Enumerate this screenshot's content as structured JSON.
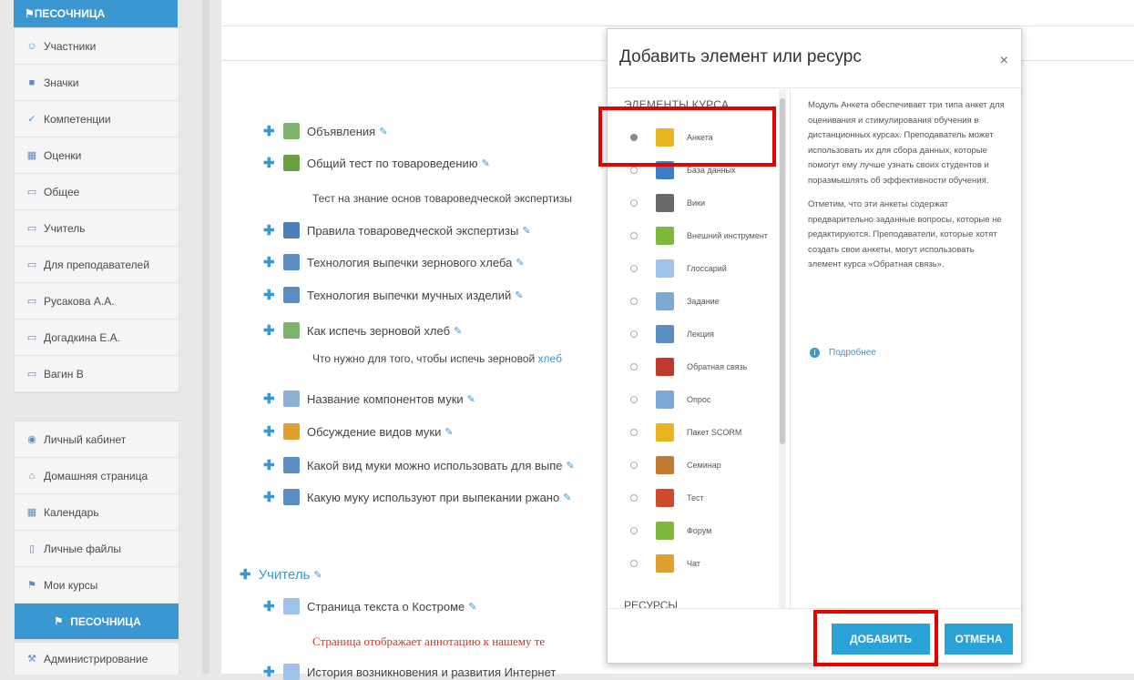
{
  "sidebar": {
    "top_label": "ПЕСОЧНИЦА",
    "group1": [
      {
        "label": "Участники",
        "icon": "users-icon"
      },
      {
        "label": "Значки",
        "icon": "badge-icon"
      },
      {
        "label": "Компетенции",
        "icon": "check-icon"
      },
      {
        "label": "Оценки",
        "icon": "table-icon"
      },
      {
        "label": "Общее",
        "icon": "folder-icon"
      },
      {
        "label": "Учитель",
        "icon": "folder-icon"
      },
      {
        "label": "Для преподавателей",
        "icon": "folder-icon"
      },
      {
        "label": "Русакова А.А.",
        "icon": "folder-icon"
      },
      {
        "label": "Догадкина Е.А.",
        "icon": "folder-icon"
      },
      {
        "label": "Вагин В",
        "icon": "folder-icon"
      }
    ],
    "group2": [
      {
        "label": "Личный кабинет",
        "icon": "dashboard-icon"
      },
      {
        "label": "Домашняя страница",
        "icon": "home-icon"
      },
      {
        "label": "Календарь",
        "icon": "calendar-icon"
      },
      {
        "label": "Личные файлы",
        "icon": "file-icon"
      },
      {
        "label": "Мои курсы",
        "icon": "graduation-cap-icon"
      }
    ],
    "active_label": "ПЕСОЧНИЦА",
    "admin_label": "Администрирование"
  },
  "course": {
    "items": [
      {
        "label": "Объявления",
        "color": "#7db36a"
      },
      {
        "label": "Общий тест по товароведению",
        "color": "#6aa03e"
      },
      {
        "label": "Правила товароведческой экспертизы",
        "color": "#4f7fb8"
      },
      {
        "label": "Технология выпечки зернового хлеба",
        "color": "#5b8cc2"
      },
      {
        "label": "Технология выпечки мучных изделий",
        "color": "#5b8cc2"
      },
      {
        "label": "Как испечь зерновой хлеб",
        "color": "#7db36a"
      },
      {
        "label": "Название компонентов муки",
        "color": "#8fb0d6"
      },
      {
        "label": "Обсуждение видов муки",
        "color": "#e0a030"
      },
      {
        "label": "Какой вид муки можно использовать для выпе",
        "color": "#5b8cc2"
      },
      {
        "label": "Какую муку используют при выпекании ржано",
        "color": "#5b8cc2"
      }
    ],
    "desc1": "Тест на знание основ товароведческой экспертизы",
    "desc2_text": "Что нужно для того, чтобы испечь зерновой ",
    "desc2_link": "хлеб",
    "section2": "Учитель",
    "page_item": "Страница текста о Костроме",
    "page_desc": "Страница отображает аннотацию к нашему те",
    "last_item": "История возникновения и развития Интернет"
  },
  "modal": {
    "title": "Добавить элемент или ресурс",
    "close": "×",
    "list_header": "ЭЛЕМЕНТЫ КУРСА",
    "items": [
      {
        "label": "Анкета",
        "color": "#e8b420",
        "selected": true
      },
      {
        "label": "База данных",
        "color": "#3a7fc4",
        "selected": false
      },
      {
        "label": "Вики",
        "color": "#6a6a6a",
        "selected": false
      },
      {
        "label": "Внешний инструмент",
        "color": "#7fb83a",
        "selected": false
      },
      {
        "label": "Глоссарий",
        "color": "#9fc3e8",
        "selected": false
      },
      {
        "label": "Задание",
        "color": "#7aa9d6",
        "selected": false
      },
      {
        "label": "Лекция",
        "color": "#5b8cc2",
        "selected": false
      },
      {
        "label": "Обратная связь",
        "color": "#c0392b",
        "selected": false
      },
      {
        "label": "Опрос",
        "color": "#7aa9d6",
        "selected": false
      },
      {
        "label": "Пакет SCORM",
        "color": "#e8b420",
        "selected": false
      },
      {
        "label": "Семинар",
        "color": "#c07a2e",
        "selected": false
      },
      {
        "label": "Тест",
        "color": "#d04a2e",
        "selected": false
      },
      {
        "label": "Форум",
        "color": "#7fb83a",
        "selected": false
      },
      {
        "label": "Чат",
        "color": "#e0a030",
        "selected": false
      }
    ],
    "resources_header": "РЕСУРСЫ",
    "description_p1": "Модуль Анкета обеспечивает три типа анкет для оценивания и стимулирования обучения в дистанционных курсах. Преподаватель может использовать их для сбора данных, которые помогут ему лучше узнать своих студентов и поразмышлять об эффективности обучения.",
    "description_p2": "Отметим, что эти анкеты содержат предварительно заданные вопросы, которые не редактируются. Преподаватели, которые хотят создать свои анкеты, могут использовать элемент курса «Обратная связь».",
    "more_link": "Подробнее",
    "add_button": "ДОБАВИТЬ",
    "cancel_button": "ОТМЕНА"
  },
  "colors": {
    "accent": "#3a97d1",
    "callout": "#e60000"
  }
}
